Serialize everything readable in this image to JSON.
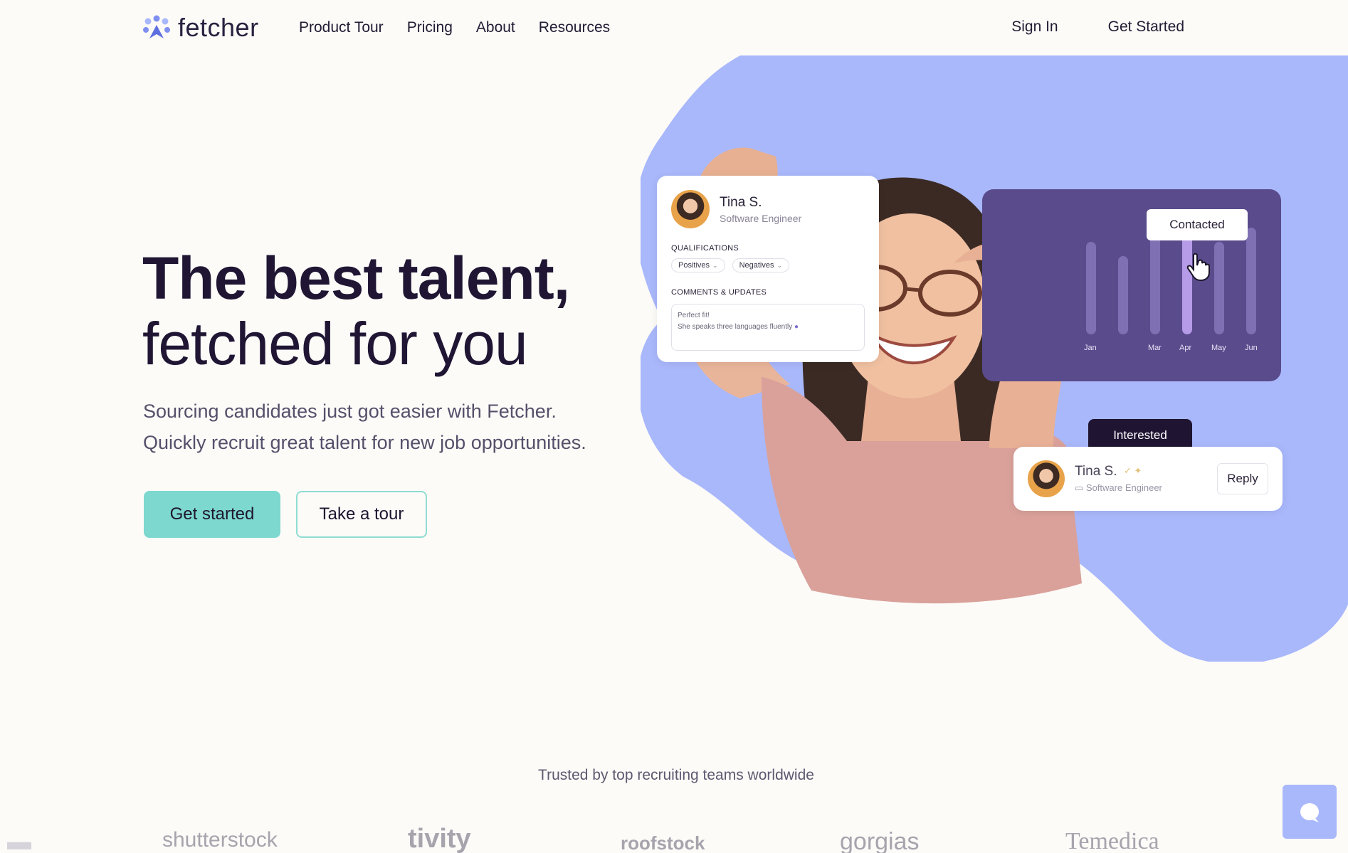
{
  "brand": {
    "name": "fetcher",
    "accent": "#7dd8cf",
    "blob_color": "#a9b8fb",
    "dark": "#1f1432"
  },
  "nav": {
    "links": [
      "Product Tour",
      "Pricing",
      "About",
      "Resources"
    ],
    "sign_in": "Sign In",
    "get_started": "Get Started"
  },
  "hero": {
    "title_line1": "The best talent,",
    "title_line2": "fetched for you",
    "subtitle_line1": "Sourcing candidates just got easier with Fetcher.",
    "subtitle_line2": "Quickly recruit great talent for new job opportunities.",
    "primary_cta": "Get started",
    "secondary_cta": "Take a tour"
  },
  "profile_card": {
    "name": "Tina S.",
    "role": "Software Engineer",
    "qualifications_label": "QUALIFICATIONS",
    "chips": [
      "Positives",
      "Negatives"
    ],
    "comments_label": "COMMENTS & UPDATES",
    "comment_line1": "Perfect fit!",
    "comment_line2": "She speaks three languages fluently"
  },
  "chart_card": {
    "tooltip": "Contacted",
    "months": [
      "Jan",
      "Mar",
      "Apr",
      "May",
      "Jun"
    ]
  },
  "reply_card": {
    "status": "Interested",
    "name": "Tina S.",
    "role": "Software Engineer",
    "reply": "Reply"
  },
  "trusted": {
    "caption": "Trusted by top recruiting teams worldwide",
    "logos": [
      "shutterstock",
      "tivity",
      "roofstock",
      "gorgias",
      "Temedica"
    ]
  }
}
